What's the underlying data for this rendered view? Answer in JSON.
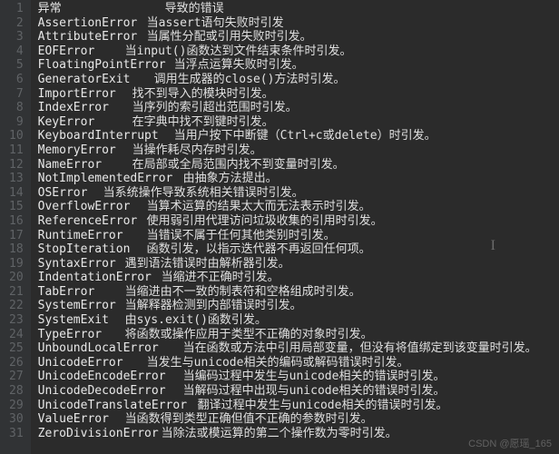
{
  "rows": [
    {
      "n": 1,
      "name": "异常",
      "desc": "导致的错误"
    },
    {
      "n": 2,
      "name": "AssertionError",
      "desc": "当assert语句失败时引发"
    },
    {
      "n": 3,
      "name": "AttributeError",
      "desc": "当属性分配或引用失败时引发。"
    },
    {
      "n": 4,
      "name": "EOFError",
      "desc": "当input()函数达到文件结束条件时引发。"
    },
    {
      "n": 5,
      "name": "FloatingPointError",
      "desc": "当浮点运算失败时引发。"
    },
    {
      "n": 6,
      "name": "GeneratorExit",
      "desc": "调用生成器的close()方法时引发。"
    },
    {
      "n": 7,
      "name": "ImportError",
      "desc": "找不到导入的模块时引发。"
    },
    {
      "n": 8,
      "name": "IndexError",
      "desc": "当序列的索引超出范围时引发。"
    },
    {
      "n": 9,
      "name": "KeyError",
      "desc": "在字典中找不到键时引发。"
    },
    {
      "n": 10,
      "name": "KeyboardInterrupt",
      "desc": "当用户按下中断键（Ctrl+c或delete）时引发。"
    },
    {
      "n": 11,
      "name": "MemoryError",
      "desc": "当操作耗尽内存时引发。"
    },
    {
      "n": 12,
      "name": "NameError",
      "desc": "在局部或全局范围内找不到变量时引发。"
    },
    {
      "n": 13,
      "name": "NotImplementedError",
      "desc": "由抽象方法提出。"
    },
    {
      "n": 14,
      "name": "OSError",
      "desc": "当系统操作导致系统相关错误时引发。"
    },
    {
      "n": 15,
      "name": "OverflowError",
      "desc": "当算术运算的结果太大而无法表示时引发。"
    },
    {
      "n": 16,
      "name": "ReferenceError",
      "desc": "使用弱引用代理访问垃圾收集的引用时引发。"
    },
    {
      "n": 17,
      "name": "RuntimeError",
      "desc": "当错误不属于任何其他类别时引发。"
    },
    {
      "n": 18,
      "name": "StopIteration",
      "desc": "函数引发，以指示迭代器不再返回任何项。"
    },
    {
      "n": 19,
      "name": "SyntaxError",
      "desc": "遇到语法错误时由解析器引发。"
    },
    {
      "n": 20,
      "name": "IndentationError",
      "desc": "当缩进不正确时引发。"
    },
    {
      "n": 21,
      "name": "TabError",
      "desc": "当缩进由不一致的制表符和空格组成时引发。"
    },
    {
      "n": 22,
      "name": "SystemError",
      "desc": "当解释器检测到内部错误时引发。"
    },
    {
      "n": 23,
      "name": "SystemExit",
      "desc": "由sys.exit()函数引发。"
    },
    {
      "n": 24,
      "name": "TypeError",
      "desc": "将函数或操作应用于类型不正确的对象时引发。"
    },
    {
      "n": 25,
      "name": "UnboundLocalError",
      "desc": "当在函数或方法中引用局部变量，但没有将值绑定到该变量时引发。"
    },
    {
      "n": 26,
      "name": "UnicodeError",
      "desc": "当发生与unicode相关的编码或解码错误时引发。"
    },
    {
      "n": 27,
      "name": "UnicodeEncodeError",
      "desc": "当编码过程中发生与unicode相关的错误时引发。"
    },
    {
      "n": 28,
      "name": "UnicodeDecodeError",
      "desc": "当解码过程中出现与unicode相关的错误时引发。"
    },
    {
      "n": 29,
      "name": "UnicodeTranslateError",
      "desc": "翻译过程中发生与unicode相关的错误时引发。"
    },
    {
      "n": 30,
      "name": "ValueError",
      "desc": "当函数得到类型正确但值不正确的参数时引发。"
    },
    {
      "n": 31,
      "name": "ZeroDivisionError",
      "desc": "当除法或模运算的第二个操作数为零时引发。"
    }
  ],
  "watermark": "CSDN @愿瑶_165"
}
